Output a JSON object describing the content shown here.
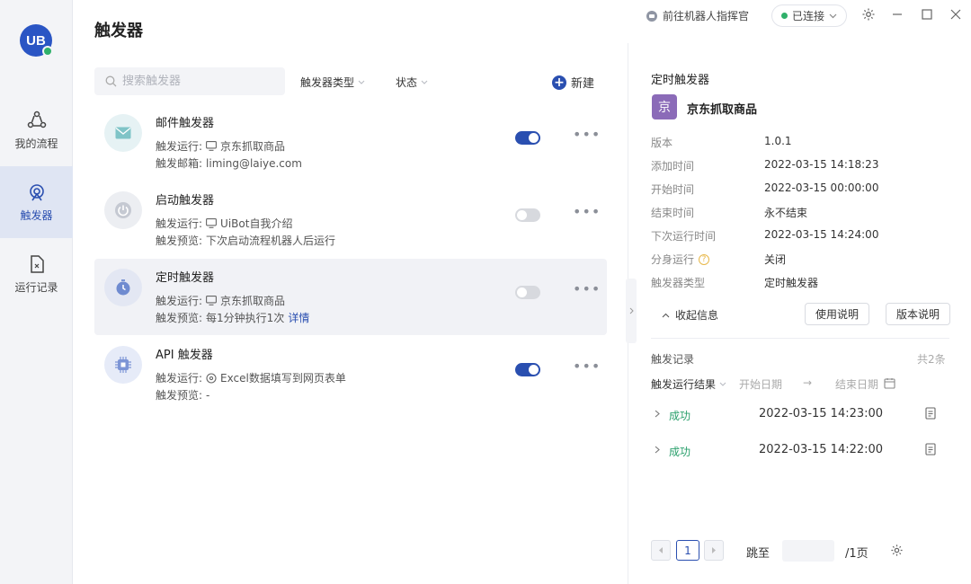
{
  "app": {
    "logo_text": "UB",
    "title": "触发器",
    "robot_link": "前往机器人指挥官",
    "connection": "已连接"
  },
  "nav": [
    {
      "label": "我的流程"
    },
    {
      "label": "触发器"
    },
    {
      "label": "运行记录"
    }
  ],
  "toolbar": {
    "search_placeholder": "搜索触发器",
    "filter_type": "触发器类型",
    "filter_status": "状态",
    "new_label": "新建"
  },
  "triggers": [
    {
      "name": "邮件触发器",
      "line1_label": "触发运行:",
      "line1_value": "京东抓取商品",
      "line2_label": "触发邮箱:",
      "line2_value": "liming@laiye.com",
      "enabled": true,
      "icon": "mail-icon"
    },
    {
      "name": "启动触发器",
      "line1_label": "触发运行:",
      "line1_value": "UiBot自我介绍",
      "line2_label": "触发预览:",
      "line2_value": "下次启动流程机器人后运行",
      "enabled": false,
      "icon": "power-icon"
    },
    {
      "name": "定时触发器",
      "line1_label": "触发运行:",
      "line1_value": "京东抓取商品",
      "line2_label": "触发预览:",
      "line2_value": "每1分钟执行1次",
      "line2_link": "详情",
      "enabled": false,
      "icon": "timer-icon"
    },
    {
      "name": "API 触发器",
      "line1_label": "触发运行:",
      "line1_value": "Excel数据填写到网页表单",
      "line2_label": "触发预览:",
      "line2_value": "-",
      "enabled": true,
      "icon": "chip-icon"
    }
  ],
  "detail": {
    "heading": "定时触发器",
    "flow_badge": "京",
    "flow_name": "京东抓取商品",
    "fields": [
      {
        "label": "版本",
        "value": "1.0.1"
      },
      {
        "label": "添加时间",
        "value": "2022-03-15 14:18:23"
      },
      {
        "label": "开始时间",
        "value": "2022-03-15 00:00:00"
      },
      {
        "label": "结束时间",
        "value": "永不结束"
      },
      {
        "label": "下次运行时间",
        "value": "2022-03-15 14:24:00"
      },
      {
        "label": "分身运行",
        "value": "关闭"
      },
      {
        "label": "触发器类型",
        "value": "定时触发器"
      }
    ],
    "fold_label": "收起信息",
    "usage_button": "使用说明",
    "version_button": "版本说明",
    "records_title": "触发记录",
    "records_count": "共2条",
    "result_filter": "触发运行结果",
    "start_date": "开始日期",
    "end_date": "结束日期",
    "records": [
      {
        "status": "成功",
        "time": "2022-03-15 14:23:00"
      },
      {
        "status": "成功",
        "time": "2022-03-15 14:22:00"
      }
    ],
    "pagination": {
      "current": "1",
      "jump_label": "跳至",
      "total": "/1页"
    }
  }
}
